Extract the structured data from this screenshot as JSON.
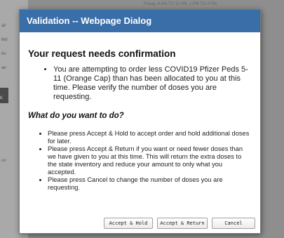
{
  "background": {
    "header_text": "Friday, 8 AM TO 11 AM, 1 PM TO 4 PM",
    "fragments": [
      "ail",
      "fed",
      "ho",
      "ae",
      "ti.",
      "ıııı"
    ]
  },
  "dialog": {
    "title": "Validation -- Webpage Dialog",
    "heading": "Your request needs confirmation",
    "intro_items": [
      "You are attempting to order less COVID19 Pfizer Peds 5-11 (Orange Cap) than has been allocated to you at this time. Please verify the number of doses you are requesting."
    ],
    "question": "What do you want to do?",
    "options": [
      "Please press Accept & Hold to accept order and hold additional doses for later.",
      "Please press Accept & Return if you want or need fewer doses than we have given to you at this time. This will return the extra doses to the state inventory and reduce your amount to only what you accepted.",
      "Please press Cancel to change the number of doses you are requesting."
    ],
    "buttons": {
      "accept_hold": "Accept & Hold",
      "accept_return": "Accept & Return",
      "cancel": "Cancel"
    }
  },
  "colors": {
    "titlebar": "#3a6ea8",
    "overlay": "#8e8e8e"
  }
}
